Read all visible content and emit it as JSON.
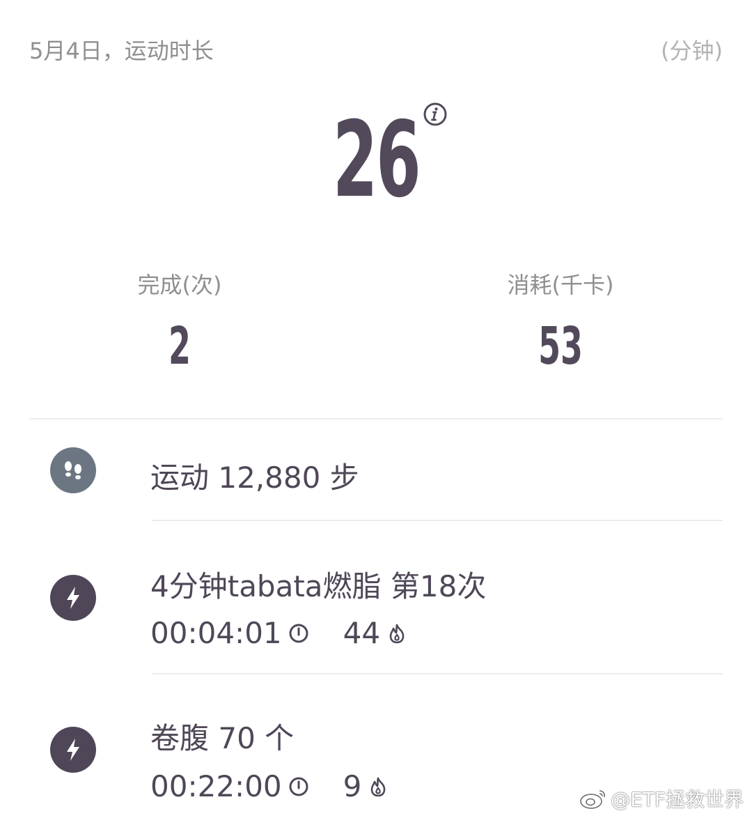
{
  "header": {
    "date_label": "5月4日，运动时长",
    "unit_label": "(分钟)"
  },
  "summary": {
    "total_minutes": "26",
    "completed_label": "完成(次)",
    "completed_value": "2",
    "calories_label": "消耗(千卡)",
    "calories_value": "53"
  },
  "activities": [
    {
      "icon": "footsteps-icon",
      "title": "运动 12,880 步"
    },
    {
      "icon": "lightning-icon",
      "title": "4分钟tabata燃脂 第18次",
      "duration": "00:04:01",
      "calories": "44"
    },
    {
      "icon": "lightning-icon",
      "title": "卷腹 70 个",
      "duration": "00:22:00",
      "calories": "9"
    }
  ],
  "watermark": "@ETF拯救世界",
  "colors": {
    "primary_text": "#4f4757",
    "secondary_text": "#8f8f8f",
    "steps_icon_bg": "#6b7682",
    "bolt_icon_bg": "#4f4757"
  }
}
